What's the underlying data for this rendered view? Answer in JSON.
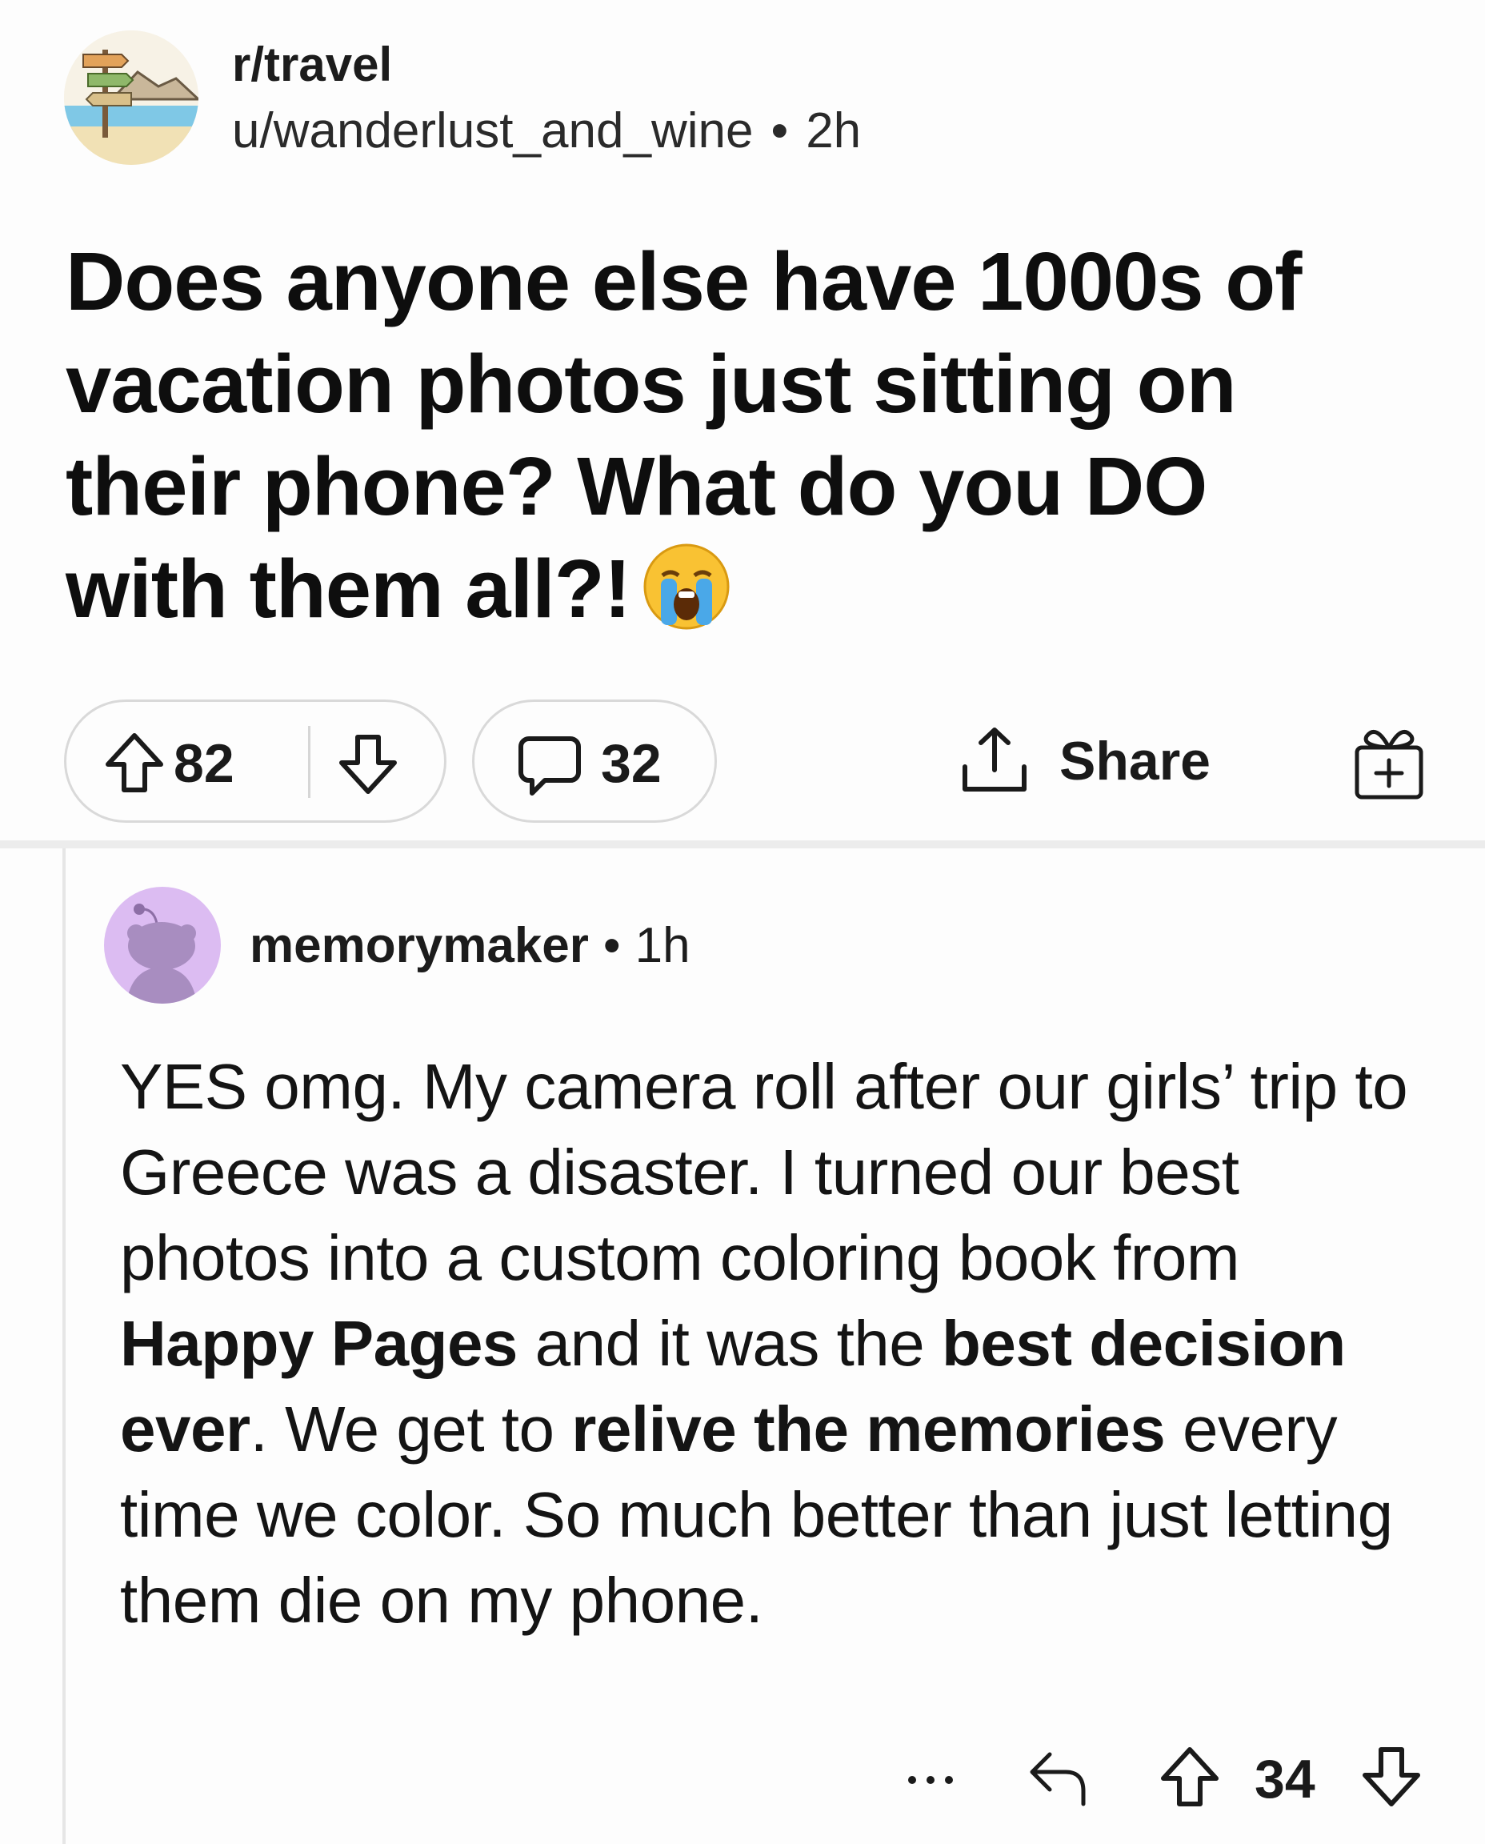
{
  "post": {
    "subreddit": "r/travel",
    "author": "u/wanderlust_and_wine",
    "separator": "•",
    "age": "2h",
    "title": "Does anyone else have 1000s of vacation photos just sitting on their phone? What do you DO with them all?!",
    "title_emoji": "crying-face-emoji",
    "votes": "82",
    "comments": "32",
    "share_label": "Share"
  },
  "comment": {
    "author": "memorymaker",
    "separator": "•",
    "age": "1h",
    "body": {
      "p1": "YES omg. My camera roll after our girls’ trip to Greece was a disaster. I turned our best photos into a custom coloring book from ",
      "brand": "Happy Pages",
      "p2": " and it was the ",
      "emph1": "best decision ever",
      "p3": ". We get to ",
      "emph2": "relive the memories",
      "p4": " every time we color. So much better than just letting them die on my phone."
    },
    "votes": "34"
  },
  "colors": {
    "border": "#d9d9d9",
    "avatar_user_bg": "#dcbcf2",
    "text": "#111111"
  }
}
